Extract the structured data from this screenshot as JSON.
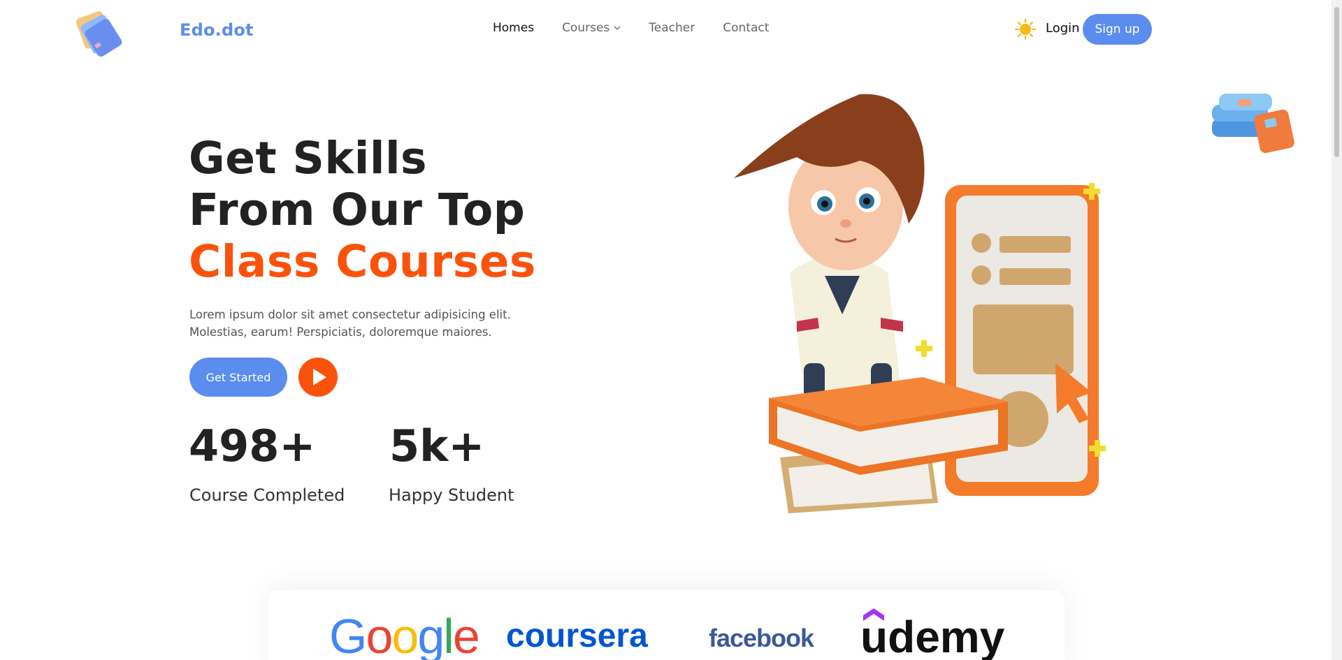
{
  "header": {
    "brand": "Edo.dot",
    "nav": [
      "Homes",
      "Courses",
      "Teacher",
      "Contact"
    ],
    "login_label": "Login",
    "signup_label": "Sign up"
  },
  "hero": {
    "title_line1": "Get Skills",
    "title_line2": "From Our Top",
    "title_line3": "Class Courses",
    "description": "Lorem ipsum dolor sit amet consectetur adipisicing elit. Molestias, earum! Perspiciatis, doloremque maiores.",
    "cta_label": "Get Started",
    "stats": [
      {
        "value": "498+",
        "label": "Course Completed"
      },
      {
        "value": "5k+",
        "label": "Happy Student"
      }
    ]
  },
  "partners": [
    "Google",
    "coursera",
    "facebook",
    "udemy"
  ],
  "colors": {
    "primary": "#5b8def",
    "accent": "#fb520b",
    "text": "#222222"
  },
  "icons": [
    "logo-books-icon",
    "chevron-down-icon",
    "sun-icon",
    "play-icon"
  ]
}
